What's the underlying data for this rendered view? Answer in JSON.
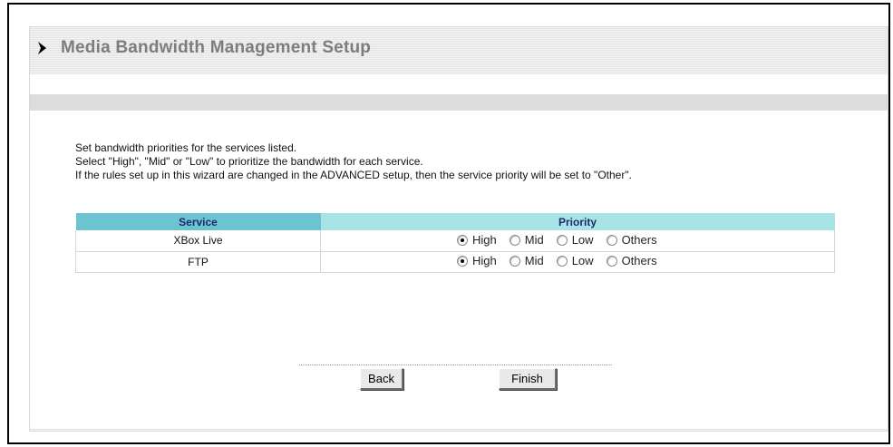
{
  "page": {
    "title": "Media Bandwidth Management Setup"
  },
  "description": {
    "line1": "Set bandwidth priorities for the services listed.",
    "line2": "Select \"High\", \"Mid\" or \"Low\" to prioritize the bandwidth for each service.",
    "line3": "If the rules set up in this wizard are changed in the ADVANCED setup, then the service priority will be set to \"Other\"."
  },
  "table": {
    "headers": {
      "service": "Service",
      "priority": "Priority"
    },
    "options": [
      "High",
      "Mid",
      "Low",
      "Others"
    ],
    "rows": [
      {
        "service": "XBox Live",
        "selected": "High"
      },
      {
        "service": "FTP",
        "selected": "High"
      }
    ]
  },
  "buttons": {
    "back": "Back",
    "finish": "Finish"
  },
  "colors": {
    "header_service_bg": "#6cc4d1",
    "header_priority_bg": "#a8e3e6",
    "title_text": "#7d7d7d"
  },
  "icons": {
    "title_arrow": "triangle-right-icon"
  }
}
